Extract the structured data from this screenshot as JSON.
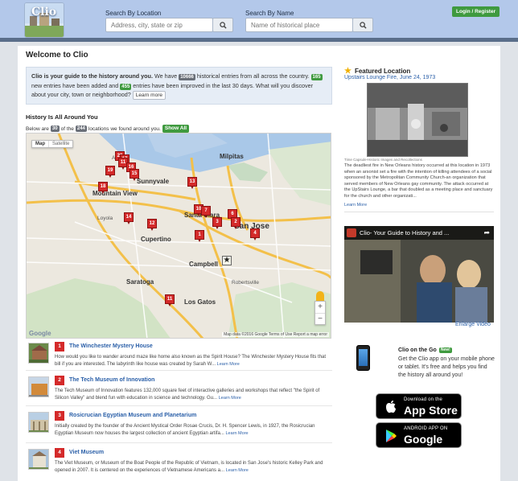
{
  "header": {
    "logo_text": "Clio",
    "location_label": "Search By Location",
    "location_placeholder": "Address, city, state or zip",
    "name_label": "Search By Name",
    "name_placeholder": "Name of historical place",
    "login_label": "Login / Register"
  },
  "intro": {
    "heading": "Welcome to Clio",
    "lead": "Clio is your guide to the history around you.",
    "t1": " We have ",
    "entries_count": "10666",
    "t2": " historical entries from all across the country. ",
    "new_count": "165",
    "t3": " new entries have been added and ",
    "improved_count": "455",
    "t4": " entries have been improved in the last 30 days. What will you discover about your city, town or neighborhood? ",
    "learn_more": "Learn more"
  },
  "map_section": {
    "title": "History Is All Around You",
    "below_prefix": "Below are",
    "shown_count": "30",
    "of_the": "of the",
    "total_count": "244",
    "below_suffix": "locations we found around you.",
    "show_all": "Show All",
    "map_tab": "Map",
    "satellite_tab": "Satellite",
    "attribution": "Map data ©2016 Google   Terms of Use   Report a map error",
    "google_logo": "Google",
    "zoom_in": "+",
    "zoom_out": "−",
    "labels": {
      "alviso": "Alviso",
      "milpitas": "Milpitas",
      "mountain_view": "Mountain View",
      "sunnyvale": "Sunnyvale",
      "santa_clara": "Santa Clara",
      "san_jose": "San Jose",
      "cupertino": "Cupertino",
      "campbell": "Campbell",
      "saratoga": "Saratoga",
      "los_gatos": "Los Gatos",
      "robertsville": "Robertsville",
      "loyola": "Loyola"
    },
    "pins": [
      "20",
      "17",
      "11",
      "16",
      "15",
      "19",
      "18",
      "13",
      "14",
      "12",
      "10",
      "7",
      "3",
      "6",
      "2",
      "1",
      "4",
      "11"
    ]
  },
  "listings": [
    {
      "num": "1",
      "title": "The Winchester Mystery House",
      "desc": "How would you like to wander around maze like home also known as the Spirit House? The Winchester Mystery House fits that bill if you are interested. The labyrinth like house was created by Sarah W... ",
      "more": "Learn More"
    },
    {
      "num": "2",
      "title": "The Tech Museum of Innovation",
      "desc": "The Tech Museum of Innovation features 132,000 square feet of interactive galleries and workshops that reflect \"the Spirit of Silicon Valley\" and blend fun with education in science and technology. Gu... ",
      "more": "Learn More"
    },
    {
      "num": "3",
      "title": "Rosicrucian Egyptian Museum and Planetarium",
      "desc": "Initially created by the founder of the Ancient Mystical Order Rosae Crucis, Dr. H. Spencer Lewis, in 1927, the Rosicrucian Egyptian Museum now houses the largest collection of ancient Egyptian artifa... ",
      "more": "Learn More"
    },
    {
      "num": "4",
      "title": "Viet Museum",
      "desc": "The Viet Museum, or Museum of the Boat People of the Republic of Vietnam, is located in San Jose's historic Kelley Park and opened in 2007. It is centered on the experiences of Vietnamese Americans a... ",
      "more": "Learn More"
    }
  ],
  "featured": {
    "heading": "Featured Location",
    "link": "Upstairs Lounge Fire, June 24, 1973",
    "caption": "Time Capsule-Historic Images and Recollections",
    "text": "The deadliest fire in New Orleans history occurred at this location in 1973 when an arsonist set a fire with the intention of killing attendees of a social sponsored by the Metropolitan Community Church-an organization that served members of New Orleans gay community. The attack occurred at the UpStairs Lounge, a bar that doubled as a meeting place and sanctuary for the church and other organizati...",
    "more": "Learn More"
  },
  "video": {
    "title": "Clio- Your Guide to History and ...",
    "enlarge": "Enlarge Video"
  },
  "app": {
    "heading": "Clio on the Go",
    "new_badge": "New!",
    "text": "Get the Clio app on your mobile phone or tablet. It's free and helps you find the history all around you!",
    "appstore_small": "Download on the",
    "appstore_big": "App Store",
    "play_small": "ANDROID APP ON",
    "play_big": "Google play"
  },
  "colors": {
    "header_bg": "#b3c8ea",
    "accent_green": "#3f9a3f",
    "pin_red": "#d42a2a",
    "link_blue": "#2a5fa8"
  }
}
